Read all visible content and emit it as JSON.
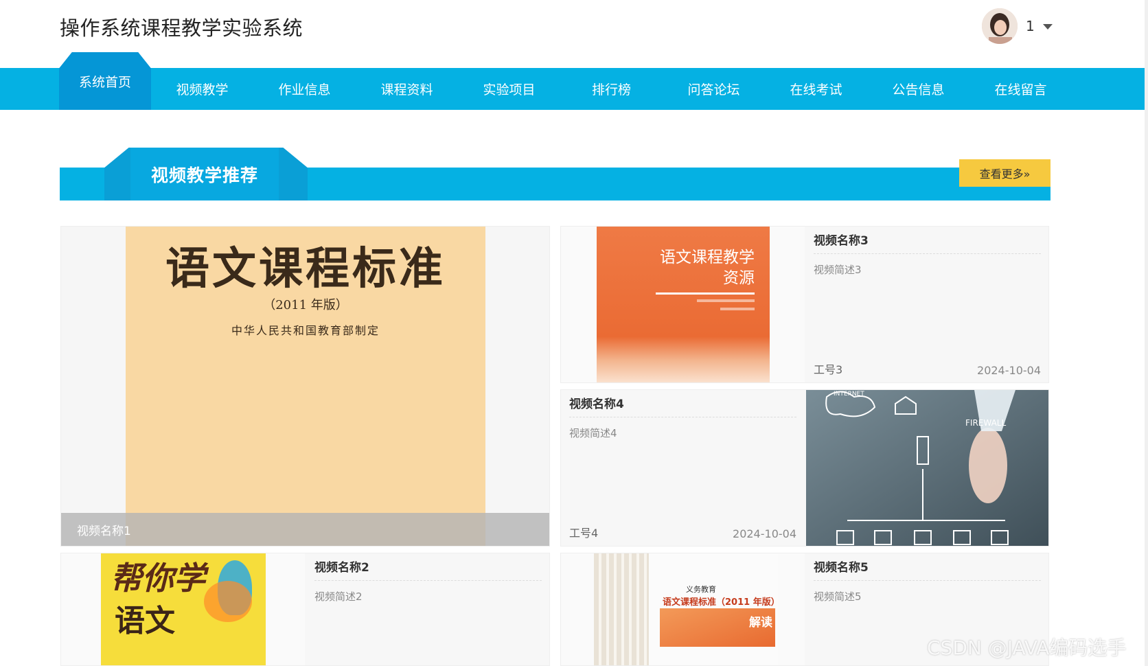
{
  "header": {
    "site_title": "操作系统课程教学实验系统",
    "user_name": "1"
  },
  "nav": {
    "active": "系统首页",
    "items": [
      "视频教学",
      "作业信息",
      "课程资料",
      "实验项目",
      "排行榜",
      "问答论坛",
      "在线考试",
      "公告信息",
      "在线留言"
    ]
  },
  "section": {
    "title": "视频教学推荐",
    "more_label": "查看更多»"
  },
  "videos": {
    "v1": {
      "name": "视频名称1",
      "cover": {
        "title": "语文课程标准",
        "edition": "（2011 年版）",
        "publisher": "中华人民共和国教育部制定"
      }
    },
    "v2": {
      "name": "视频名称2",
      "desc": "视频简述2",
      "cover": {
        "title": "帮你学",
        "subject": "语文"
      }
    },
    "v3": {
      "name": "视频名称3",
      "desc": "视频简述3",
      "author": "工号3",
      "date": "2024-10-04",
      "cover": {
        "line1": "语文课程教学",
        "line2": "资源"
      }
    },
    "v4": {
      "name": "视频名称4",
      "desc": "视频简述4",
      "author": "工号4",
      "date": "2024-10-04",
      "cover": {
        "label": "FIREWALL",
        "label2": "INTERNET"
      }
    },
    "v5": {
      "name": "视频名称5",
      "desc": "视频简述5",
      "cover": {
        "line1": "义务教育",
        "line2": "语文课程标准（2011 年版）",
        "line3": "解读"
      }
    }
  },
  "watermark": "CSDN @JAVA编码选手",
  "colors": {
    "nav_blue": "#05b1e3",
    "active_blue": "#0596d6",
    "more_yellow": "#f6c93f"
  }
}
